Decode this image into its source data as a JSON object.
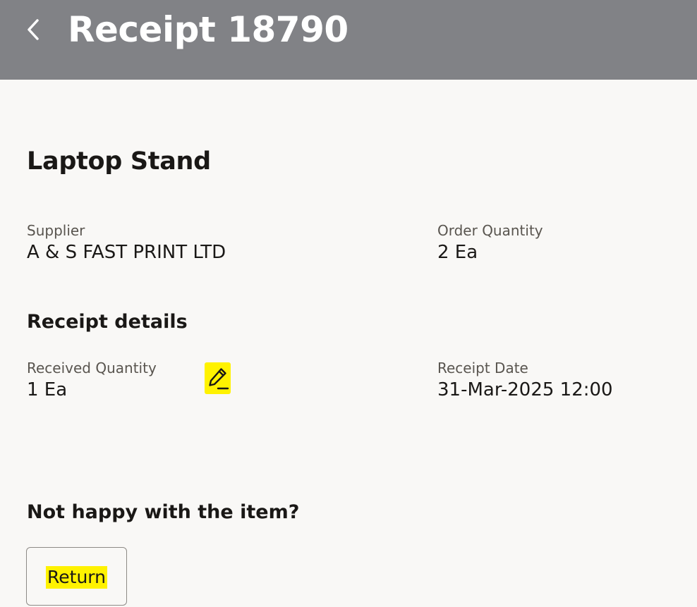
{
  "header": {
    "title": "Receipt 18790",
    "back_icon": "chevron-left-icon"
  },
  "item": {
    "title": "Laptop Stand"
  },
  "summary": {
    "supplier_label": "Supplier",
    "supplier_value": "A & S FAST PRINT LTD",
    "order_quantity_label": "Order Quantity",
    "order_quantity_value": "2 Ea"
  },
  "receipt_details": {
    "title": "Receipt details",
    "received_quantity_label": "Received Quantity",
    "received_quantity_value": "1 Ea",
    "edit_icon": "pencil-icon",
    "receipt_date_label": "Receipt Date",
    "receipt_date_value": "31-Mar-2025 12:00"
  },
  "return_section": {
    "title": "Not happy with the item?",
    "button_label": "Return"
  },
  "colors": {
    "header_bg": "#818286",
    "page_bg": "#f9f8f6",
    "highlight": "#fff200"
  }
}
